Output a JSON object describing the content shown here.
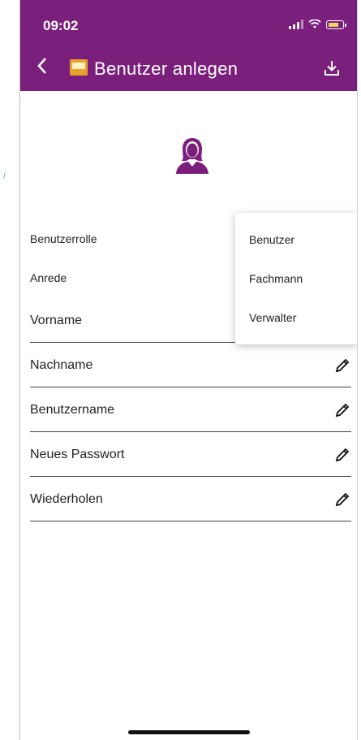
{
  "status": {
    "time": "09:02"
  },
  "header": {
    "title": "Benutzer anlegen"
  },
  "fields": {
    "role_label": "Benutzerrolle",
    "salutation_label": "Anrede",
    "firstname_label": "Vorname",
    "lastname_label": "Nachname",
    "username_label": "Benutzername",
    "password_label": "Neues Passwort",
    "repeat_label": "Wiederholen"
  },
  "role_menu": {
    "options": [
      "Benutzer",
      "Fachmann",
      "Verwalter"
    ]
  },
  "icons": {
    "back": "chevron-left-icon",
    "logo": "heat-app-logo",
    "download": "download-icon",
    "avatar": "user-avatar-icon",
    "edit": "pencil-icon"
  },
  "colors": {
    "header": "#7b1f7d",
    "avatar": "#7b1f7d"
  }
}
